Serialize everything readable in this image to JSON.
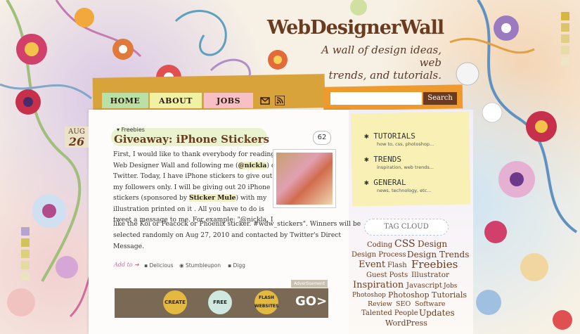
{
  "brand": {
    "logo": "WebDesignerWall",
    "tagline": [
      "A wall of design ideas, web",
      "trends, and tutorials."
    ]
  },
  "nav": [
    {
      "label": "HOME"
    },
    {
      "label": "ABOUT"
    },
    {
      "label": "JOBS"
    }
  ],
  "nav_icons": [
    "mail-icon",
    "rss-icon"
  ],
  "search": {
    "value": "",
    "button": "Search"
  },
  "post": {
    "date": {
      "month": "AUG",
      "day": "26"
    },
    "category": "Freebies",
    "title": "Giveaway: iPhone Stickers",
    "comments": "62",
    "lines": [
      "First, I would like to thank everybody for reading",
      "Web Designer Wall and following me (",
      "@nickla",
      ") on",
      "Twitter. Today, I have iPhone stickers to give out to",
      "my followers only. I will be giving out 20 iPhone",
      "stickers (sponsored by ",
      "Sticker Mule",
      ") with my",
      "illustration printed on it . All you have to do is",
      "tweet a message to me. For example: \"@nickla, I",
      "like the Koi or Peacock or Phoenix sticker. #wdw_stickers\". Winners will be",
      "selected randomly on Aug 27, 2010 and contacted by Twitter's Direct",
      "Message."
    ],
    "add_to": "Add to",
    "share": [
      "Delicious",
      "Stumbleupon",
      "Digg"
    ]
  },
  "ad": {
    "label": "Advertisement",
    "buttons": [
      "CREATE",
      "FREE",
      "FLASH WEBSITES"
    ],
    "go": "GO>"
  },
  "sidebar": {
    "sections": [
      {
        "title": "TUTORIALS",
        "sub": "how to, css, photoshop..."
      },
      {
        "title": "TRENDS",
        "sub": "inspiration, web trends..."
      },
      {
        "title": "GENERAL",
        "sub": "news, technology, etc..."
      }
    ],
    "tagcloud_title": "TAG CLOUD",
    "tags": [
      "Coding",
      "CSS",
      "Design",
      "Design Process",
      "Design Trends",
      "Event",
      "Flash",
      "Freebies",
      "Guest Posts",
      "Illustrator",
      "Inspiration",
      "Javascript",
      "Jobs",
      "Photoshop",
      "Photoshop Tutorials",
      "Review",
      "SEO",
      "Software",
      "Talented People",
      "Updates",
      "WordPress"
    ]
  },
  "colors": {
    "brown": "#6b3b20",
    "home": "#b9e0a5",
    "about": "#f1f1a3",
    "jobs": "#f6c0c4",
    "search": "#ee9a2c"
  }
}
